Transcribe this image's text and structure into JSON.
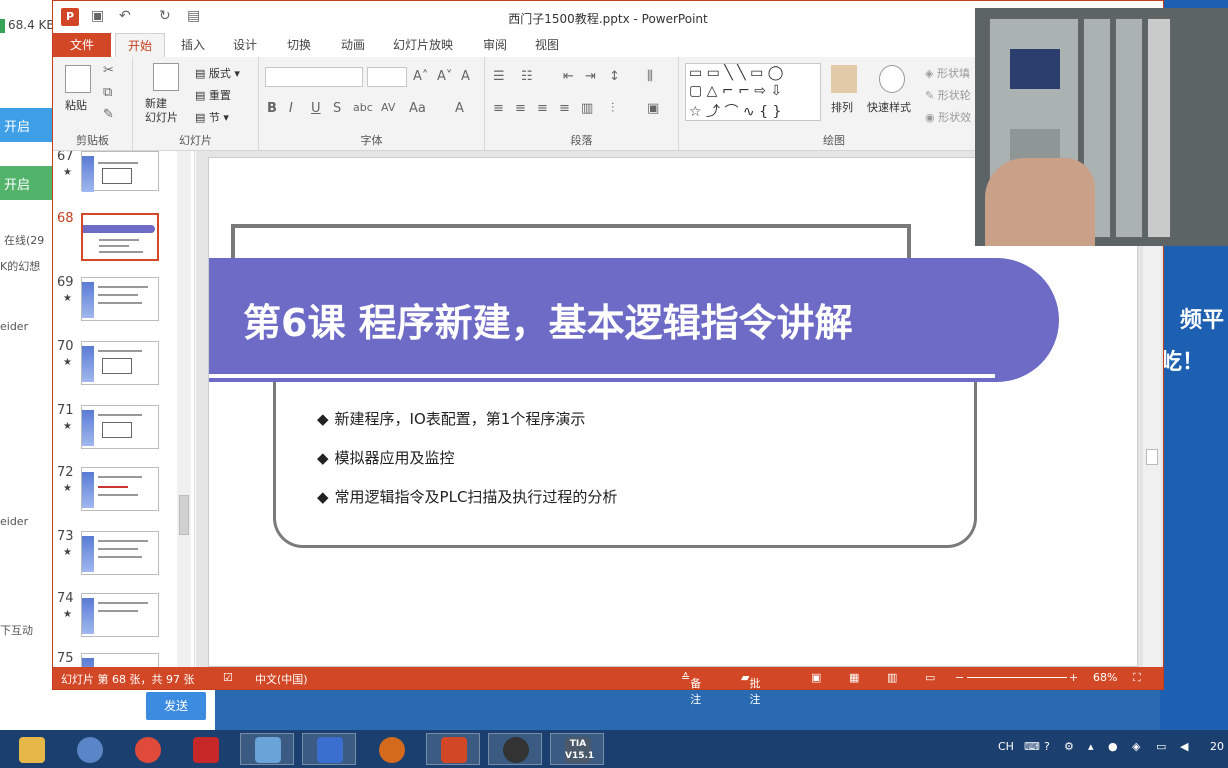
{
  "bg_app": {
    "size_label": "68.4 KB",
    "btn1": "开启",
    "btn2": "开启",
    "online": "在线(29",
    "t1": "K的幻想",
    "t2": "eider",
    "t3": "eider",
    "t4": "下互动",
    "send": "发送",
    "right_text1": "频平",
    "right_text2": "屹！"
  },
  "window": {
    "title": "西门子1500教程.pptx - PowerPoint",
    "logo": "P"
  },
  "tabs": [
    "文件",
    "开始",
    "插入",
    "设计",
    "切换",
    "动画",
    "幻灯片放映",
    "审阅",
    "视图"
  ],
  "ribbon": {
    "paste": "粘贴",
    "new_slide": "新建\n幻灯片",
    "layout": "版式",
    "reset": "重置",
    "section": "节",
    "arrange": "排列",
    "quick_styles": "快速样式",
    "shape_fill": "形状填",
    "shape_outline": "形状轮",
    "shape_effects": "形状效",
    "groups": {
      "clipboard": "剪贴板",
      "slides": "幻灯片",
      "font": "字体",
      "paragraph": "段落",
      "drawing": "绘图"
    }
  },
  "thumbnails": [
    {
      "num": "67",
      "star": "★"
    },
    {
      "num": "68",
      "star": ""
    },
    {
      "num": "69",
      "star": "★"
    },
    {
      "num": "70",
      "star": "★"
    },
    {
      "num": "71",
      "star": "★"
    },
    {
      "num": "72",
      "star": "★"
    },
    {
      "num": "73",
      "star": "★"
    },
    {
      "num": "74",
      "star": "★"
    },
    {
      "num": "75",
      "star": ""
    }
  ],
  "slide": {
    "title": "第6课  程序新建，基本逻辑指令讲解",
    "bullet_mark": "◆",
    "bullets": [
      "新建程序，IO表配置，第1个程序演示",
      "模拟器应用及监控",
      "常用逻辑指令及PLC扫描及执行过程的分析"
    ]
  },
  "status": {
    "slide_info": "幻灯片 第 68 张，共 97 张",
    "lang": "中文(中国)",
    "notes": "备注",
    "comments": "批注",
    "zoom": "68%"
  },
  "taskbar": {
    "tia_label": "TIA\nV15.1",
    "tray_ch": "CH",
    "tray_year": "20"
  },
  "colors": {
    "ppt_accent": "#d24726",
    "banner": "#6e6bc6"
  }
}
